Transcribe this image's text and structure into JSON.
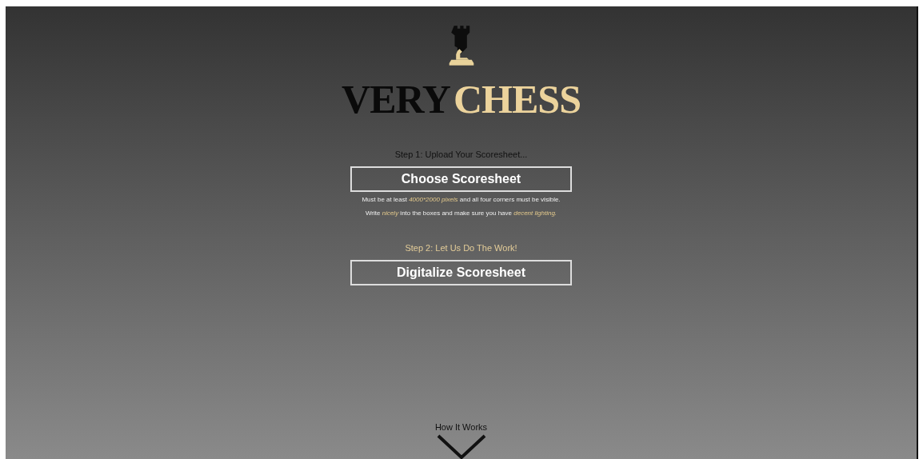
{
  "logo": {
    "words": [
      {
        "text": "VERY",
        "kind": "dark"
      },
      {
        "text": "CHESS",
        "kind": "gold"
      }
    ]
  },
  "step1": {
    "label": "Step 1: Upload Your Scoresheet...",
    "button": "Choose Scoresheet",
    "notes": [
      [
        {
          "text": "Must be at least ",
          "highlight": false
        },
        {
          "text": "4000*2000 pixels",
          "highlight": true
        },
        {
          "text": " and all four corners must be visible.",
          "highlight": false
        }
      ],
      [
        {
          "text": "Write ",
          "highlight": false
        },
        {
          "text": "nicely",
          "highlight": true
        },
        {
          "text": " into the boxes and make sure you have ",
          "highlight": false
        },
        {
          "text": "decent lighting.",
          "highlight": true
        }
      ]
    ]
  },
  "step2": {
    "label": "Step 2: Let Us Do The Work!",
    "button": "Digitalize Scoresheet"
  },
  "footer": {
    "link": "How It Works"
  }
}
